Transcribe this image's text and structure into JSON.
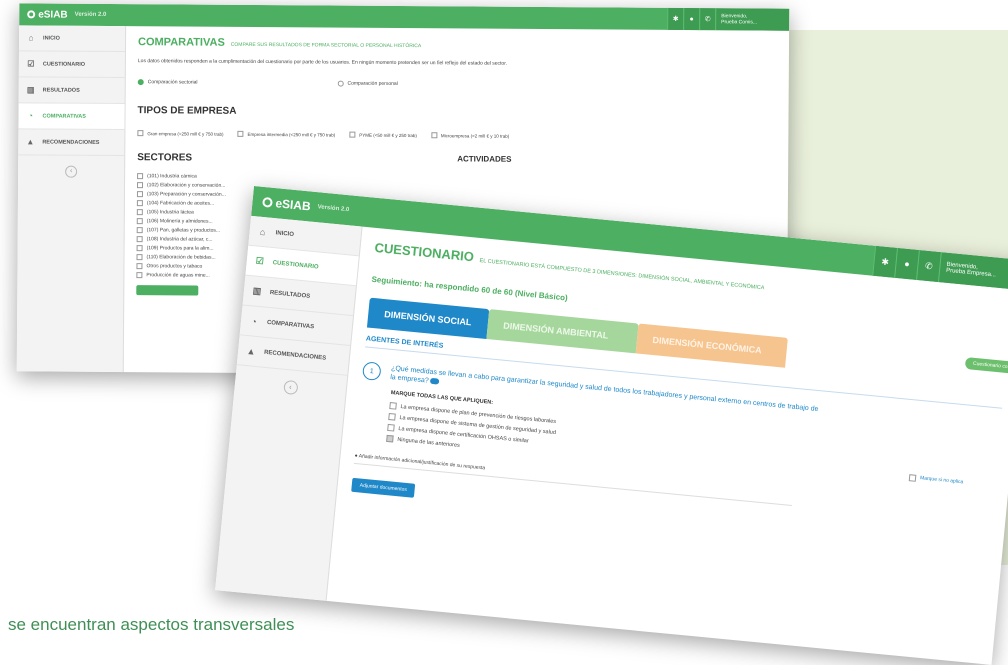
{
  "caption": "se encuentran aspectos transversales",
  "colors": {
    "brand_green": "#4caf61",
    "accent_blue": "#1e88c8",
    "tab_env": "#a5d79d",
    "tab_eco": "#f6c48e",
    "panel_bg": "#e8efda"
  },
  "window_back": {
    "app_name": "eSIAB",
    "version": "Versión 2.0",
    "topbar_user": {
      "line1": "Bienvenido,",
      "line2": "Prueba Comis..."
    },
    "topbar_icons": [
      "settings-icon",
      "globe-icon",
      "phone-icon"
    ],
    "nav": [
      {
        "label": "INICIO",
        "icon": "home-icon"
      },
      {
        "label": "CUESTIONARIO",
        "icon": "checklist-icon"
      },
      {
        "label": "RESULTADOS",
        "icon": "bar-chart-icon"
      },
      {
        "label": "COMPARATIVAS",
        "icon": "pie-chart-icon",
        "active": true
      },
      {
        "label": "RECOMENDACIONES",
        "icon": "thumbs-up-icon"
      }
    ],
    "page": {
      "title": "COMPARATIVAS",
      "subtitle": "COMPARE SUS RESULTADOS DE FORMA SECTORIAL O PERSONAL HISTÓRICA",
      "description": "Los datos obtenidos responden a la cumplimentación del cuestionario por parte de los usuarios. En ningún momento pretenden ser un fiel reflejo del estado del sector.",
      "radio_sectorial": "Comparación sectorial",
      "radio_personal": "Comparación personal",
      "tipos_title": "TIPOS DE EMPRESA",
      "tipos": [
        "Gran empresa (>250 mill € y 750 trab)",
        "Empresa intermedia (<250 mill € y 750 trab)",
        "PYME (<50 mill € y 250 trab)",
        "Microempresa (<2 mill € y 10 trab)"
      ],
      "sectores_title": "SECTORES",
      "actividades_title": "ACTIVIDADES",
      "sectores": [
        "(101) Industria cárnica",
        "(102) Elaboración y conservación...",
        "(103) Preparación y conservación...",
        "(104) Fabricación de aceites...",
        "(105) Industria láctea",
        "(106) Molinería y almidones...",
        "(107) Pan, galletas y productos...",
        "(108) Industria del azúcar, c...",
        "(109) Productos para la alim...",
        "(110) Elaboración de bebidas...",
        "Otros productos y tabaco",
        "Producción de aguas mine..."
      ]
    }
  },
  "window_front": {
    "app_name": "eSIAB",
    "version": "Versión 2.0",
    "topbar_user": {
      "line1": "Bienvenido,",
      "line2": "Prueba Empresa..."
    },
    "topbar_icons": [
      "settings-icon",
      "globe-icon",
      "phone-icon"
    ],
    "nav": [
      {
        "label": "INICIO",
        "icon": "home-icon"
      },
      {
        "label": "CUESTIONARIO",
        "icon": "checklist-icon",
        "active": true
      },
      {
        "label": "RESULTADOS",
        "icon": "bar-chart-icon"
      },
      {
        "label": "COMPARATIVAS",
        "icon": "pie-chart-icon"
      },
      {
        "label": "RECOMENDACIONES",
        "icon": "thumbs-up-icon"
      }
    ],
    "page": {
      "title": "CUESTIONARIO",
      "subtitle": "EL CUESTIONARIO ESTÁ COMPUESTO DE 3 DIMENSIONES: DIMENSIÓN SOCIAL, AMBIENTAL Y ECONÓMICA",
      "seguimiento": "Seguimiento: ha respondido 60 de 60 (Nivel Básico)",
      "tabs": [
        "DIMENSIÓN SOCIAL",
        "DIMENSIÓN AMBIENTAL",
        "DIMENSIÓN ECONÓMICA"
      ],
      "status_pill": "Cuestionario completado",
      "section": "AGENTES DE INTERÉS",
      "question_number": "1",
      "question": "¿Qué medidas se llevan a cabo para garantizar la seguridad y salud de todos los trabajadores y personal externo en centros de trabajo de la empresa?",
      "mark_all": "MARQUE TODAS LAS QUE APLIQUEN:",
      "options": [
        {
          "label": "La empresa dispone de plan de prevención de riesgos laborales",
          "checked": false
        },
        {
          "label": "La empresa dispone de sistema de gestión de seguridad y salud",
          "checked": false
        },
        {
          "label": "La empresa dispone de certificación OHSAS o similar",
          "checked": false
        },
        {
          "label": "Ninguna de las anteriores",
          "checked": true
        }
      ],
      "no_aplica": "Marque si no aplica",
      "add_info": "Añadir información adicional/justificación de su respuesta",
      "attach_button": "Adjuntar documentos"
    }
  }
}
